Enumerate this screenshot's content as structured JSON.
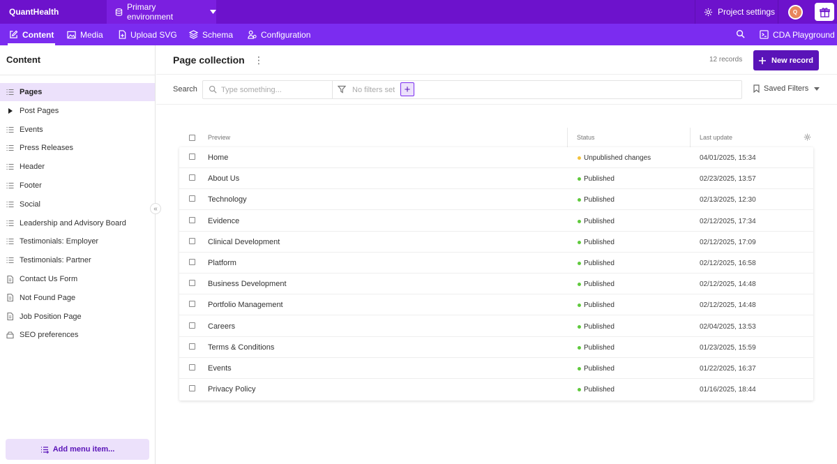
{
  "topbar": {
    "brand": "QuantHealth",
    "environment": "Primary environment",
    "project_settings": "Project settings",
    "avatar_initial": "Q"
  },
  "nav": {
    "items": [
      {
        "label": "Content",
        "icon": "edit-icon"
      },
      {
        "label": "Media",
        "icon": "image-icon"
      },
      {
        "label": "Upload SVG",
        "icon": "file-plus-icon"
      },
      {
        "label": "Schema",
        "icon": "layers-icon"
      },
      {
        "label": "Configuration",
        "icon": "config-icon"
      }
    ],
    "cda": "CDA Playground"
  },
  "sidebar": {
    "title": "Content",
    "items": [
      {
        "label": "Pages",
        "icon": "list-icon",
        "active": true
      },
      {
        "label": "Post Pages",
        "icon": "caret-right-icon"
      },
      {
        "label": "Events",
        "icon": "list-icon"
      },
      {
        "label": "Press Releases",
        "icon": "list-icon"
      },
      {
        "label": "Header",
        "icon": "list-icon"
      },
      {
        "label": "Footer",
        "icon": "list-icon"
      },
      {
        "label": "Social",
        "icon": "list-icon"
      },
      {
        "label": "Leadership and Advisory Board",
        "icon": "list-icon"
      },
      {
        "label": "Testimonials: Employer",
        "icon": "list-icon"
      },
      {
        "label": "Testimonials: Partner",
        "icon": "list-icon"
      },
      {
        "label": "Contact Us Form",
        "icon": "doc-icon"
      },
      {
        "label": "Not Found Page",
        "icon": "doc-icon"
      },
      {
        "label": "Job Position Page",
        "icon": "doc-icon"
      },
      {
        "label": "SEO preferences",
        "icon": "box-icon"
      }
    ],
    "add_menu": "Add menu item..."
  },
  "main": {
    "title": "Page collection",
    "records": "12 records",
    "new_record": "New record",
    "search_label": "Search",
    "search_placeholder": "Type something...",
    "no_filters": "No filters set",
    "saved_filters": "Saved Filters"
  },
  "table": {
    "columns": [
      "Preview",
      "Status",
      "Last update"
    ],
    "rows": [
      {
        "title": "Home",
        "status": "Unpublished changes",
        "date": "04/01/2025, 15:34"
      },
      {
        "title": "About Us",
        "status": "Published",
        "date": "02/23/2025, 13:57"
      },
      {
        "title": "Technology",
        "status": "Published",
        "date": "02/13/2025, 12:30"
      },
      {
        "title": "Evidence",
        "status": "Published",
        "date": "02/12/2025, 17:34"
      },
      {
        "title": "Clinical Development",
        "status": "Published",
        "date": "02/12/2025, 17:09"
      },
      {
        "title": "Platform",
        "status": "Published",
        "date": "02/12/2025, 16:58"
      },
      {
        "title": "Business Development",
        "status": "Published",
        "date": "02/12/2025, 14:48"
      },
      {
        "title": "Portfolio Management",
        "status": "Published",
        "date": "02/12/2025, 14:48"
      },
      {
        "title": "Careers",
        "status": "Published",
        "date": "02/04/2025, 13:53"
      },
      {
        "title": "Terms & Conditions",
        "status": "Published",
        "date": "01/23/2025, 15:59"
      },
      {
        "title": "Events",
        "status": "Published",
        "date": "01/22/2025, 16:37"
      },
      {
        "title": "Privacy Policy",
        "status": "Published",
        "date": "01/16/2025, 18:44"
      }
    ]
  },
  "colors": {
    "topbar": "#6d12cc",
    "navbar": "#7b2cf0",
    "accent": "#5a14b8",
    "published": "#5fc93c",
    "unpublished": "#f3c23b"
  }
}
